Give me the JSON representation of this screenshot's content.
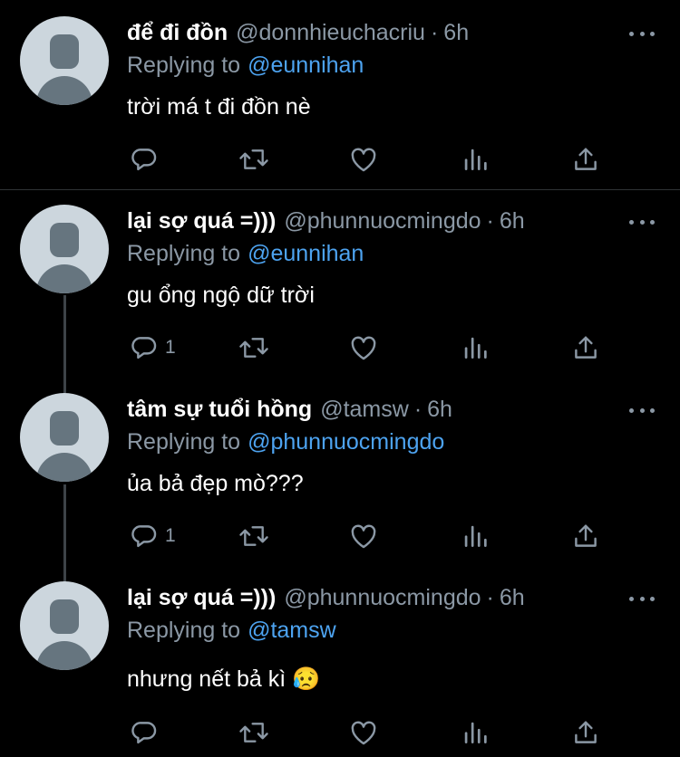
{
  "tweets": [
    {
      "name": "để đi đồn",
      "handle": "@donnhieuchacriu",
      "separator": "·",
      "time": "6h",
      "replying_prefix": "Replying to",
      "replying_to": "@eunnihan",
      "text": "trời má t đi đồn nè",
      "reply_count": ""
    },
    {
      "name": "lại sợ quá =)))",
      "handle": "@phunnuocmingdo",
      "separator": "·",
      "time": "6h",
      "replying_prefix": "Replying to",
      "replying_to": "@eunnihan",
      "text": "gu ổng ngộ dữ trời",
      "reply_count": "1"
    },
    {
      "name": "tâm sự tuổi hồng",
      "handle": "@tamsw",
      "separator": "·",
      "time": "6h",
      "replying_prefix": "Replying to",
      "replying_to": "@phunnuocmingdo",
      "text": "ủa bả đẹp mò???",
      "reply_count": "1"
    },
    {
      "name": "lại sợ quá =)))",
      "handle": "@phunnuocmingdo",
      "separator": "·",
      "time": "6h",
      "replying_prefix": "Replying to",
      "replying_to": "@tamsw",
      "text": "nhưng nết bả kì 😥",
      "reply_count": ""
    }
  ],
  "icons": [
    "reply-icon",
    "retweet-icon",
    "like-icon",
    "analytics-icon",
    "share-icon",
    "more-icon"
  ],
  "colors": {
    "background": "#000000",
    "name": "#ffffff",
    "secondary": "#8b98a5",
    "link": "#4da3f0",
    "divider": "#2f3336",
    "thread_line": "#3d4348"
  }
}
